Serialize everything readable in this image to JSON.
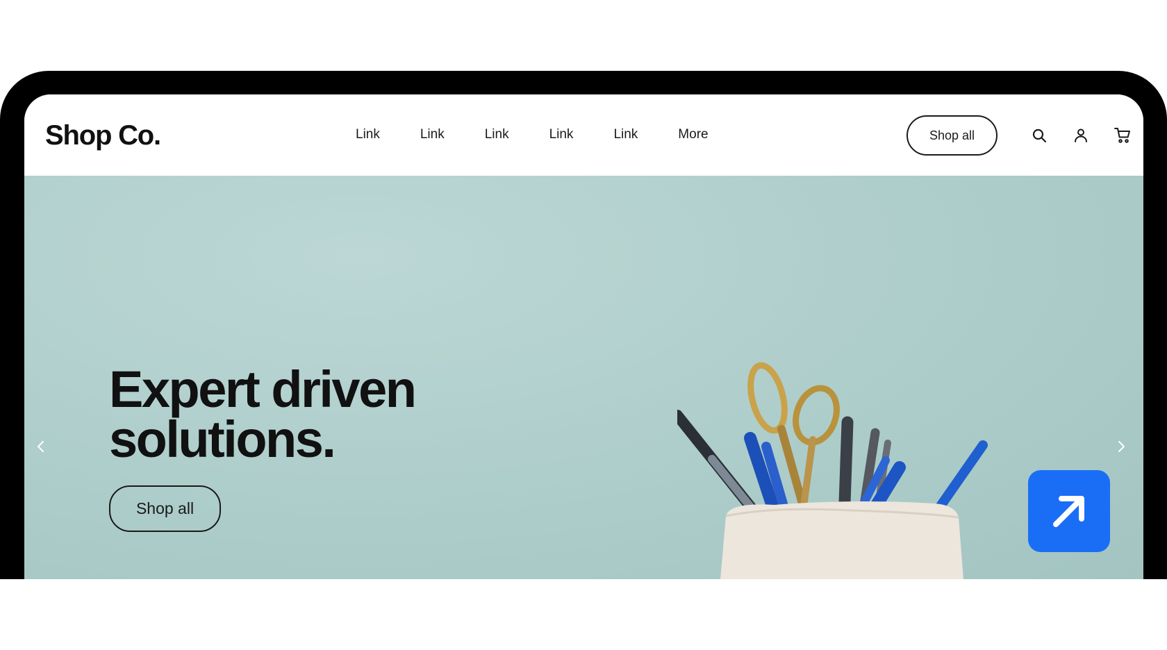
{
  "header": {
    "logo": "Shop Co.",
    "nav": [
      "Link",
      "Link",
      "Link",
      "Link",
      "Link",
      "More"
    ],
    "cta_label": "Shop all",
    "icons": [
      "search-icon",
      "user-icon",
      "cart-icon"
    ]
  },
  "hero": {
    "headline_line1": "Expert driven",
    "headline_line2": "solutions.",
    "cta_label": "Shop all",
    "background_color": "#adcdca",
    "image": "pen-cup-with-scissors",
    "prev_icon": "chevron-left-icon",
    "next_icon": "chevron-right-icon"
  },
  "badge": {
    "icon": "arrow-up-right-icon",
    "color": "#1a6ef6"
  }
}
